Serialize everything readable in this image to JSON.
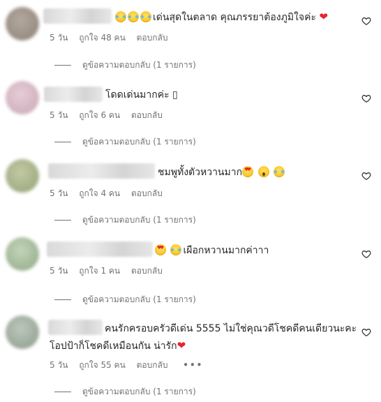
{
  "comments": [
    {
      "text": "เด่นสุดในตลาด คุณภรรยาต้องภูมิใจค่ะ",
      "time": "5 วัน",
      "likes": "ถูกใจ 48 คน",
      "reply": "ตอบกลับ",
      "view_replies": "ดูข้อความตอบกลับ (1 รายการ)",
      "avatar_color": "#9a8f86"
    },
    {
      "text": "โดดเด่นมากค่ะ ▯",
      "time": "5 วัน",
      "likes": "ถูกใจ 6 คน",
      "reply": "ตอบกลับ",
      "view_replies": "ดูข้อความตอบกลับ (1 รายการ)",
      "avatar_color": "#d8b8c4"
    },
    {
      "text": "ชมพูทั้งตัวหวานมาก",
      "time": "5 วัน",
      "likes": "ถูกใจ 4 คน",
      "reply": "ตอบกลับ",
      "view_replies": "ดูข้อความตอบกลับ (1 รายการ)",
      "avatar_color": "#a9b58c"
    },
    {
      "text": "เผือกหวานมากค่าาา",
      "time": "5 วัน",
      "likes": "ถูกใจ 1 คน",
      "reply": "ตอบกลับ",
      "view_replies": "ดูข้อความตอบกลับ (1 รายการ)",
      "avatar_color": "#a6bb9c"
    },
    {
      "text": "คนรักครอบครัวดีเด่น 5555 ไม่ใช่คุณวดีโชคดีคนเดียวนะคะ โอปป้าก็โชคดีเหมือนกัน น่ารัก",
      "time": "5 วัน",
      "likes": "ถูกใจ 55 คน",
      "reply": "ตอบกลับ",
      "more": "•••",
      "view_replies": "ดูข้อความตอบกลับ (1 รายการ)",
      "avatar_color": "#9aa89a"
    }
  ],
  "colors": {
    "text": "#262626",
    "secondary": "#737373",
    "heart_red": "#e8232f"
  }
}
